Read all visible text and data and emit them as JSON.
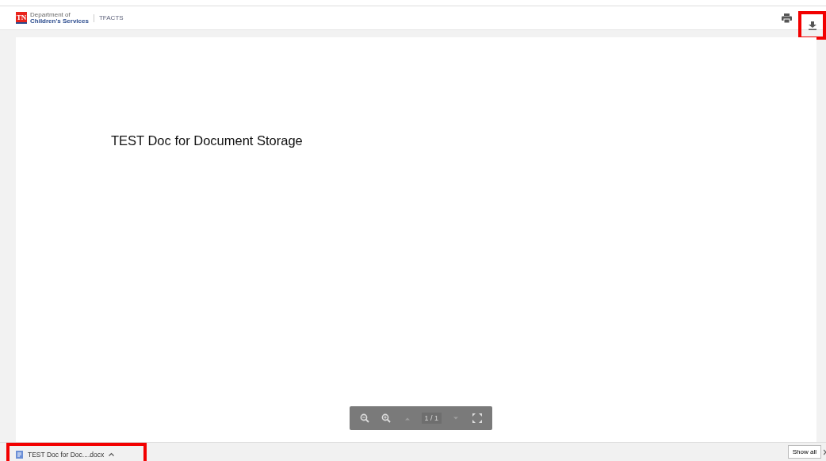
{
  "header": {
    "logo": {
      "badge": "TN",
      "line_1": "Department of",
      "line_2": "Children's Services"
    },
    "app_name": "TFACTS",
    "actions": [
      {
        "kind": "print",
        "highlighted": false
      },
      {
        "kind": "download",
        "highlighted": true
      }
    ]
  },
  "document": {
    "heading": "TEST Doc for Document Storage"
  },
  "viewer_toolbar": {
    "items": [
      {
        "kind": "zoom_out",
        "disabled": false
      },
      {
        "kind": "zoom_in",
        "disabled": false
      },
      {
        "kind": "previous",
        "disabled": true
      },
      {
        "kind": "page",
        "text": "1 / 1",
        "disabled": true
      },
      {
        "kind": "next",
        "disabled": true
      },
      {
        "kind": "fullscreen",
        "disabled": false
      }
    ]
  },
  "download_bar": {
    "items": [
      {
        "file_name": "TEST Doc for Doc....docx",
        "highlighted": true
      }
    ],
    "show_all": "Show all"
  }
}
